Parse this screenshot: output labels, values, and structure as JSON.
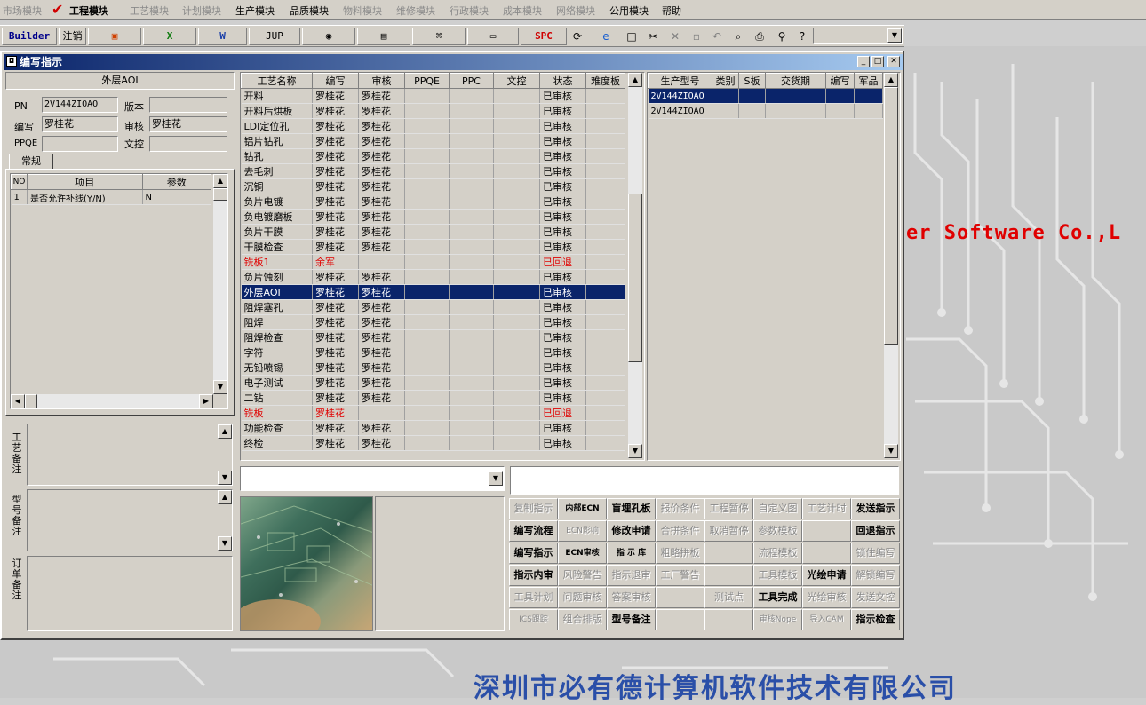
{
  "menu": {
    "items": [
      {
        "label": "市场模块",
        "enabled": false
      },
      {
        "label": "工程模块",
        "enabled": true
      },
      {
        "label": "工艺模块",
        "enabled": false
      },
      {
        "label": "计划模块",
        "enabled": false
      },
      {
        "label": "生产模块",
        "enabled": true
      },
      {
        "label": "品质模块",
        "enabled": true
      },
      {
        "label": "物料模块",
        "enabled": false
      },
      {
        "label": "维修模块",
        "enabled": false
      },
      {
        "label": "行政模块",
        "enabled": false
      },
      {
        "label": "成本模块",
        "enabled": false
      },
      {
        "label": "网络模块",
        "enabled": false
      },
      {
        "label": "公用模块",
        "enabled": true
      },
      {
        "label": "帮助",
        "enabled": true
      }
    ]
  },
  "toolbar": {
    "builder": "Builder",
    "logout": "注销",
    "jup": "JUP",
    "spc": "SPC"
  },
  "window": {
    "title": "编写指示"
  },
  "left": {
    "process_title": "外层AOI",
    "pn_label": "PN",
    "pn_value": "2V144ZIOAO",
    "version_label": "版本",
    "version_value": "",
    "writer_label": "编写",
    "writer_value": "罗桂花",
    "review_label": "审核",
    "review_value": "罗桂花",
    "ppqe_label": "PPQE",
    "ppqe_value": "",
    "wenkong_label": "文控",
    "wenkong_value": "",
    "tab": "常规",
    "params_headers": [
      "NO",
      "项目",
      "参数"
    ],
    "params_rows": [
      {
        "no": "1",
        "item": "是否允许补线(Y/N)",
        "value": "N"
      }
    ],
    "process_note": "工艺备注",
    "model_note": "型号备注",
    "order_note": "订单备注"
  },
  "process": {
    "headers": [
      "工艺名称",
      "编写",
      "审核",
      "PPQE",
      "PPC",
      "文控",
      "状态",
      "难度板"
    ],
    "rows": [
      {
        "name": "开料",
        "writer": "罗桂花",
        "reviewer": "罗桂花",
        "status": "已审核"
      },
      {
        "name": "开料后烘板",
        "writer": "罗桂花",
        "reviewer": "罗桂花",
        "status": "已审核"
      },
      {
        "name": "LDI定位孔",
        "writer": "罗桂花",
        "reviewer": "罗桂花",
        "status": "已审核"
      },
      {
        "name": "铝片钻孔",
        "writer": "罗桂花",
        "reviewer": "罗桂花",
        "status": "已审核"
      },
      {
        "name": "钻孔",
        "writer": "罗桂花",
        "reviewer": "罗桂花",
        "status": "已审核"
      },
      {
        "name": "去毛刺",
        "writer": "罗桂花",
        "reviewer": "罗桂花",
        "status": "已审核"
      },
      {
        "name": "沉铜",
        "writer": "罗桂花",
        "reviewer": "罗桂花",
        "status": "已审核"
      },
      {
        "name": "负片电镀",
        "writer": "罗桂花",
        "reviewer": "罗桂花",
        "status": "已审核"
      },
      {
        "name": "负电镀磨板",
        "writer": "罗桂花",
        "reviewer": "罗桂花",
        "status": "已审核"
      },
      {
        "name": "负片干膜",
        "writer": "罗桂花",
        "reviewer": "罗桂花",
        "status": "已审核"
      },
      {
        "name": "干膜检查",
        "writer": "罗桂花",
        "reviewer": "罗桂花",
        "status": "已审核"
      },
      {
        "name": "铣板1",
        "writer": "余军",
        "reviewer": "",
        "status": "已回退",
        "red": true
      },
      {
        "name": "负片蚀刻",
        "writer": "罗桂花",
        "reviewer": "罗桂花",
        "status": "已审核"
      },
      {
        "name": "外层AOI",
        "writer": "罗桂花",
        "reviewer": "罗桂花",
        "status": "已审核",
        "selected": true
      },
      {
        "name": "阻焊塞孔",
        "writer": "罗桂花",
        "reviewer": "罗桂花",
        "status": "已审核"
      },
      {
        "name": "阻焊",
        "writer": "罗桂花",
        "reviewer": "罗桂花",
        "status": "已审核"
      },
      {
        "name": "阻焊检查",
        "writer": "罗桂花",
        "reviewer": "罗桂花",
        "status": "已审核"
      },
      {
        "name": "字符",
        "writer": "罗桂花",
        "reviewer": "罗桂花",
        "status": "已审核"
      },
      {
        "name": "无铅喷锡",
        "writer": "罗桂花",
        "reviewer": "罗桂花",
        "status": "已审核"
      },
      {
        "name": "电子测试",
        "writer": "罗桂花",
        "reviewer": "罗桂花",
        "status": "已审核"
      },
      {
        "name": "二钻",
        "writer": "罗桂花",
        "reviewer": "罗桂花",
        "status": "已审核"
      },
      {
        "name": "铣板",
        "writer": "罗桂花",
        "reviewer": "",
        "status": "已回退",
        "red": true
      },
      {
        "name": "功能检查",
        "writer": "罗桂花",
        "reviewer": "罗桂花",
        "status": "已审核"
      },
      {
        "name": "终检",
        "writer": "罗桂花",
        "reviewer": "罗桂花",
        "status": "已审核"
      }
    ]
  },
  "models": {
    "headers": [
      "生产型号",
      "类别",
      "S板",
      "交货期",
      "编写",
      "军品"
    ],
    "rows": [
      {
        "model": "2V144ZIOAO",
        "selected": true
      },
      {
        "model": "2V144ZIOAO",
        "selected": false
      }
    ]
  },
  "actions": [
    [
      "复制指示",
      "内部ECN",
      "盲埋孔板",
      "报价条件",
      "工程暂停",
      "自定义图",
      "工艺计时",
      "发送指示"
    ],
    [
      "编写流程",
      "ECN影响",
      "修改申请",
      "合拼条件",
      "取消暂停",
      "参数模板",
      "",
      "回退指示"
    ],
    [
      "编写指示",
      "ECN审核",
      "指 示 库",
      "粗略拼板",
      "",
      "流程模板",
      "",
      "锁住编写"
    ],
    [
      "指示内审",
      "风险警告",
      "指示退审",
      "工厂警告",
      "",
      "工具模板",
      "光绘申请",
      "解锁编写"
    ],
    [
      "工具计划",
      "问题审核",
      "答案审核",
      "",
      "测试点",
      "工具完成",
      "光绘审核",
      "发送文控"
    ],
    [
      "ICS跟踪",
      "组合排版",
      "型号备注",
      "",
      "",
      "审核Nope",
      "导入CAM",
      "指示检查"
    ]
  ],
  "actions_enabled": [
    [
      false,
      true,
      true,
      false,
      false,
      false,
      false,
      true
    ],
    [
      true,
      false,
      true,
      false,
      false,
      false,
      false,
      true
    ],
    [
      true,
      true,
      true,
      false,
      false,
      false,
      false,
      false
    ],
    [
      true,
      false,
      false,
      false,
      false,
      false,
      true,
      false
    ],
    [
      false,
      false,
      false,
      false,
      false,
      true,
      false,
      false
    ],
    [
      false,
      false,
      true,
      false,
      false,
      false,
      false,
      true
    ]
  ],
  "background": {
    "brand_text": "er Software Co.,L",
    "company": "深圳市必有德计算机软件技术有限公司"
  }
}
